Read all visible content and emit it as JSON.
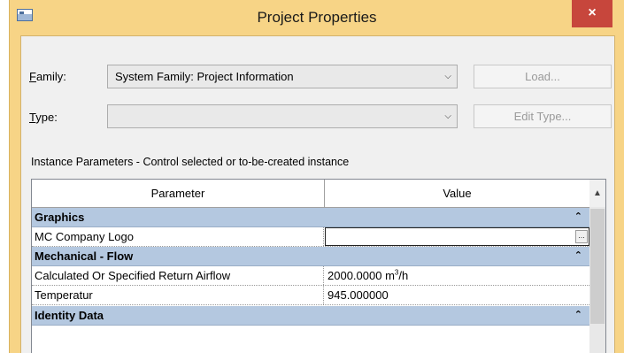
{
  "window": {
    "title": "Project Properties",
    "close_label": "×"
  },
  "family": {
    "label_accel": "F",
    "label_rest": "amily:",
    "value": "System Family: Project Information",
    "load_button": "Load..."
  },
  "type": {
    "label_accel": "T",
    "label_rest": "ype:",
    "value": "",
    "edit_type_button": "Edit Type..."
  },
  "instance_parameters_label": "Instance Parameters - Control selected or to-be-created instance",
  "grid": {
    "headers": {
      "parameter": "Parameter",
      "value": "Value"
    },
    "groups": {
      "graphics": "Graphics",
      "mechanical_flow": "Mechanical - Flow",
      "identity_data": "Identity Data"
    },
    "rows": {
      "mc_company_logo": {
        "parameter": "MC Company Logo",
        "value": ""
      },
      "return_airflow": {
        "parameter": "Calculated Or Specified Return Airflow",
        "value_prefix": "2000.0000 m",
        "value_sup": "3",
        "value_suffix": "/h"
      },
      "temperatur": {
        "parameter": "Temperatur",
        "value": "945.000000"
      }
    },
    "ellipsis": "..."
  },
  "colors": {
    "title_bar": "#f7d486",
    "close_button": "#c7463c",
    "group_header": "#b4c8e0"
  }
}
